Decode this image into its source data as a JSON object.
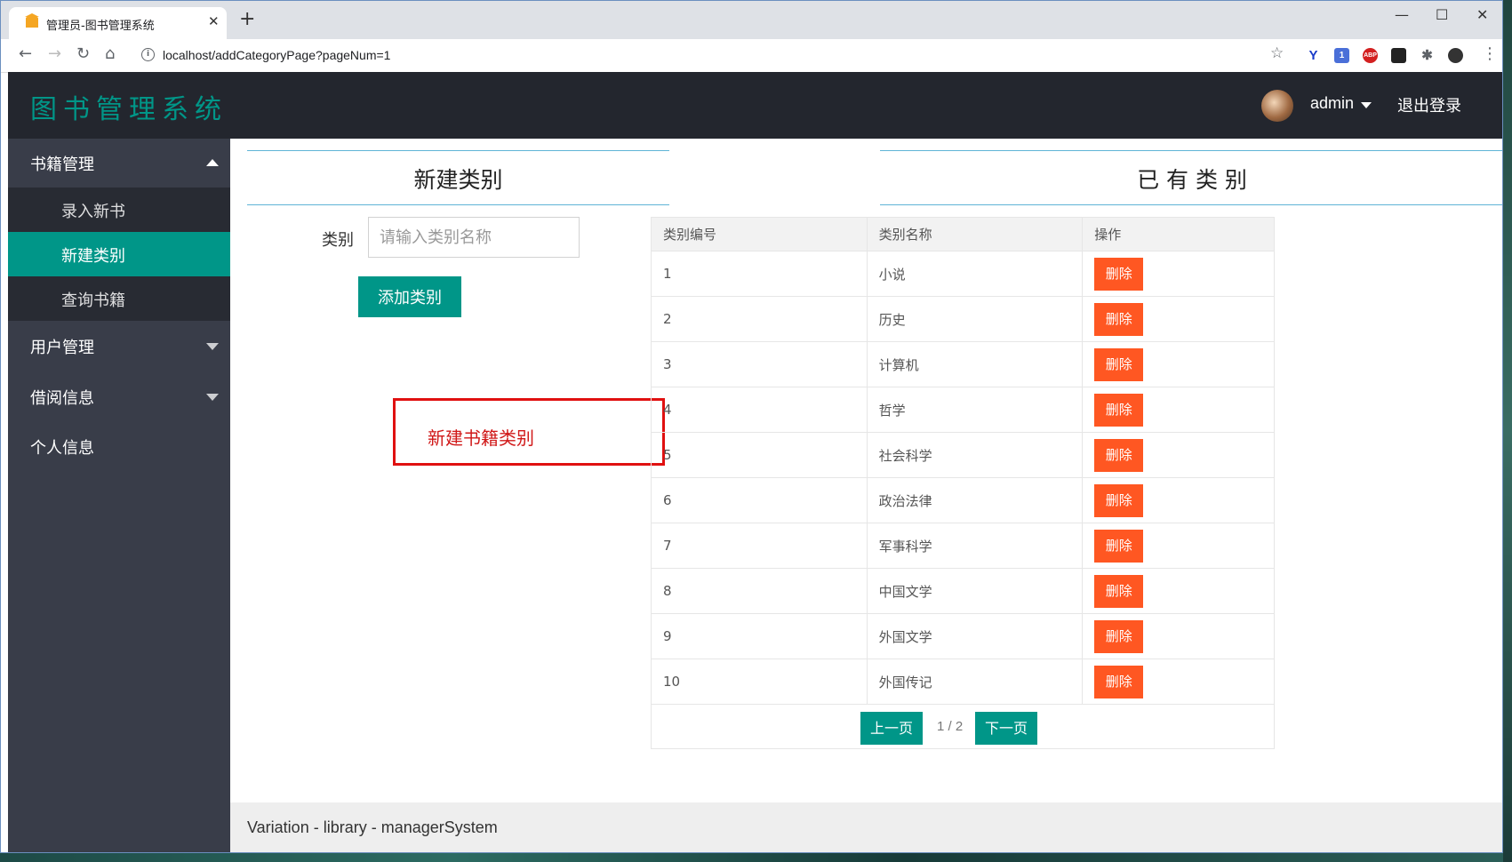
{
  "browser": {
    "tab_title": "管理员-图书管理系统",
    "url": "localhost/addCategoryPage?pageNum=1",
    "window_controls": {
      "minimize": "—",
      "maximize": "☐",
      "close": "✕"
    }
  },
  "header": {
    "logo": "图书管理系统",
    "user_name": "admin",
    "logout_label": "退出登录"
  },
  "sidebar": {
    "groups": [
      {
        "label": "书籍管理",
        "expanded": true,
        "children": [
          {
            "label": "录入新书",
            "active": false
          },
          {
            "label": "新建类别",
            "active": true
          },
          {
            "label": "查询书籍",
            "active": false
          }
        ]
      },
      {
        "label": "用户管理",
        "expanded": false
      },
      {
        "label": "借阅信息",
        "expanded": false
      },
      {
        "label": "个人信息",
        "expanded": false
      }
    ]
  },
  "new_category": {
    "title": "新建类别",
    "field_label": "类别",
    "placeholder": "请输入类别名称",
    "submit_label": "添加类别",
    "annotation": "新建书籍类别"
  },
  "existing": {
    "title": "已 有 类 别",
    "columns": [
      "类别编号",
      "类别名称",
      "操作"
    ],
    "delete_label": "删除",
    "rows": [
      {
        "id": "1",
        "name": "小说"
      },
      {
        "id": "2",
        "name": "历史"
      },
      {
        "id": "3",
        "name": "计算机"
      },
      {
        "id": "4",
        "name": "哲学"
      },
      {
        "id": "5",
        "name": "社会科学"
      },
      {
        "id": "6",
        "name": "政治法律"
      },
      {
        "id": "7",
        "name": "军事科学"
      },
      {
        "id": "8",
        "name": "中国文学"
      },
      {
        "id": "9",
        "name": "外国文学"
      },
      {
        "id": "10",
        "name": "外国传记"
      }
    ],
    "pager": {
      "prev": "上一页",
      "info": "1 / 2",
      "next": "下一页"
    }
  },
  "footer": {
    "text": "Variation - library - managerSystem"
  },
  "colors": {
    "accent": "#009688",
    "danger": "#ff5722",
    "header_bg": "#23262e",
    "sidebar_bg": "#393d49"
  }
}
